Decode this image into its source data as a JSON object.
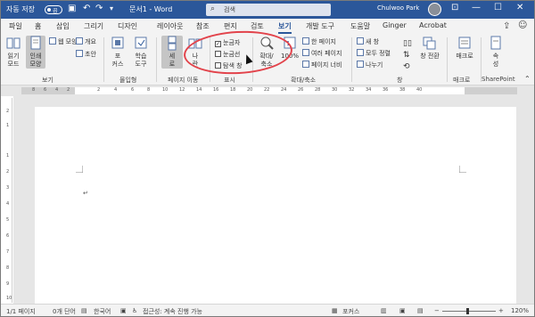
{
  "titlebar": {
    "autosave_label": "자동 저장",
    "autosave_state": "끔",
    "doc_title": "문서1  -  Word",
    "search_placeholder": "검색",
    "user_name": "Chulwoo Park"
  },
  "tabs": [
    "파일",
    "홈",
    "삽입",
    "그리기",
    "디자인",
    "레이아웃",
    "참조",
    "편지",
    "검토",
    "보기",
    "개발 도구",
    "도움말",
    "Ginger",
    "Acrobat"
  ],
  "active_tab": "보기",
  "ribbon": {
    "views": {
      "read_mode": "읽기\n모드",
      "print_layout": "인쇄\n모양",
      "web_layout": "웹 모양",
      "outline": "개요",
      "draft": "초안",
      "label": "보기"
    },
    "immersive": {
      "focus": "포\n커스",
      "learning": "학습\n도구",
      "label": "몰입형"
    },
    "page_move": {
      "vertical": "세\n로",
      "side": "나\n란",
      "label": "페이지 이동"
    },
    "show": {
      "ruler": "눈금자",
      "gridlines": "눈금선",
      "nav_pane": "탐색 창",
      "label": "표시"
    },
    "zoom": {
      "zoom": "확대/\n축소",
      "hundred": "100%",
      "one_page": "한 페이지",
      "multi_page": "여러 페이지",
      "page_width": "페이지 너비",
      "label": "확대/축소"
    },
    "window": {
      "new_window": "새 창",
      "arrange_all": "모두 정렬",
      "split": "나누기",
      "switch": "창 전환",
      "label": "창"
    },
    "macros": {
      "macro": "매크로",
      "label": "매크로"
    },
    "sharepoint": {
      "properties": "속\n성",
      "label": "SharePoint"
    }
  },
  "ruler_ticks": [
    "8",
    "6",
    "4",
    "2",
    "2",
    "4",
    "6",
    "8",
    "10",
    "12",
    "14",
    "16",
    "18",
    "20",
    "22",
    "24",
    "26",
    "28",
    "30",
    "32",
    "34",
    "36",
    "38",
    "40"
  ],
  "vruler_ticks": [
    "2",
    "1",
    "1",
    "2",
    "3",
    "4",
    "5",
    "6",
    "7",
    "8",
    "9",
    "10"
  ],
  "paragraph_mark": "↵",
  "status": {
    "page": "1/1 페이지",
    "words": "0개 단어",
    "language": "한국어",
    "accessibility": "접근성: 계속 진행 가능",
    "focus": "포커스",
    "zoom": "120%"
  },
  "colors": {
    "accent": "#2b579a",
    "annotation": "#e2434b"
  }
}
